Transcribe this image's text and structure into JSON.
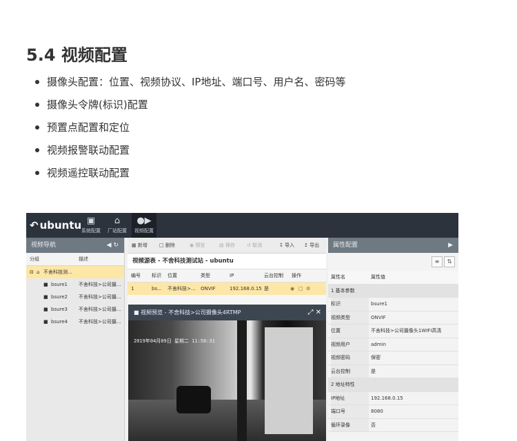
{
  "section": {
    "heading": "5.4 视频配置"
  },
  "bullets": [
    "摄像头配置：位置、视频协议、IP地址、端口号、用户名、密码等",
    "摄像头令牌(标识)配置",
    "预置点配置和定位",
    "视频报警联动配置",
    "视频遥控联动配置"
  ],
  "app": {
    "logo": "ubuntu",
    "nav": [
      {
        "label": "系统配置",
        "icon": "monitor-icon"
      },
      {
        "label": "厂站配置",
        "icon": "home-icon"
      },
      {
        "label": "视频配置",
        "icon": "camera-icon"
      }
    ],
    "left": {
      "title": "视频导航",
      "col_group": "分组",
      "col_desc": "描述",
      "root": "不舍科技测...",
      "items": [
        {
          "name": "bsure1",
          "desc": "不舍科技>公司摄..."
        },
        {
          "name": "bsure2",
          "desc": "不舍科技>公司摄..."
        },
        {
          "name": "bsure3",
          "desc": "不舍科技>公司摄..."
        },
        {
          "name": "bsure4",
          "desc": "不舍科技>公司摄..."
        }
      ]
    },
    "toolbar": {
      "add": "新增",
      "delete": "删除",
      "preview": "预览",
      "save": "保存",
      "cancel": "取消",
      "import": "导入",
      "export": "导出"
    },
    "table": {
      "title": "视频源表 - 不舍科技测试站 - ubuntu",
      "headers": [
        "编号",
        "标识",
        "位置",
        "类型",
        "IP",
        "云台控制",
        "操作"
      ],
      "row": [
        "1",
        "bs...",
        "不舍科技>...",
        "ONVIF",
        "192.168.0.15",
        "是"
      ]
    },
    "preview": {
      "title": "视频预览 - 不舍科技>公司摄像头4RTMP",
      "osd": "2019年04月09日 星期二 11:58:31"
    },
    "right": {
      "title": "属性配置",
      "col_name": "属性名",
      "col_value": "属性值",
      "section1": "1 基本参数",
      "props1": [
        {
          "k": "标识",
          "v": "bsure1"
        },
        {
          "k": "视频类型",
          "v": "ONVIF"
        },
        {
          "k": "位置",
          "v": "不舍科技>公司摄像头1WIFI高清"
        },
        {
          "k": "视频用户",
          "v": "admin"
        },
        {
          "k": "视频密码",
          "v": "保密"
        },
        {
          "k": "云台控制",
          "v": "是"
        }
      ],
      "section2": "2 地址特性",
      "props2": [
        {
          "k": "IP地址",
          "v": "192.168.0.15"
        },
        {
          "k": "端口号",
          "v": "8080"
        },
        {
          "k": "循环录像",
          "v": "否"
        }
      ]
    }
  }
}
